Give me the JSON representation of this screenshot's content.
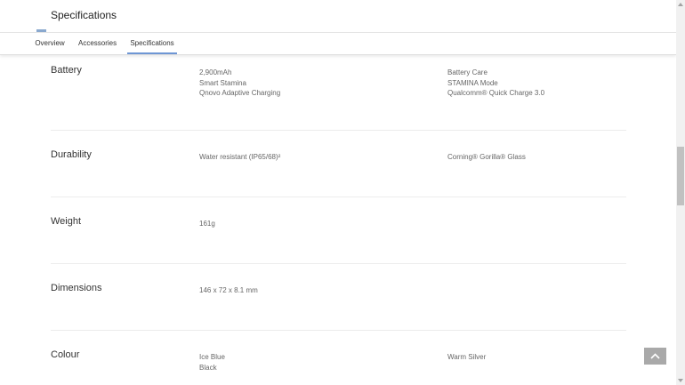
{
  "header": {
    "title": "Specifications"
  },
  "tabs": [
    {
      "label": "Overview"
    },
    {
      "label": "Accessories"
    },
    {
      "label": "Specifications",
      "active": true
    }
  ],
  "specs": {
    "battery": {
      "label": "Battery",
      "col1": [
        "2,900mAh",
        "Smart Stamina",
        "Qnovo Adaptive Charging"
      ],
      "col2": [
        "Battery Care",
        "STAMINA Mode",
        "Qualcomm® Quick Charge 3.0"
      ]
    },
    "durability": {
      "label": "Durability",
      "col1": [
        "Water resistant (IP65/68)²"
      ],
      "col2": [
        "Corning® Gorilla® Glass"
      ]
    },
    "weight": {
      "label": "Weight",
      "col1": [
        "161g"
      ]
    },
    "dimensions": {
      "label": "Dimensions",
      "col1": [
        "146 x 72 x 8.1 mm"
      ]
    },
    "colour": {
      "label": "Colour",
      "col1": [
        "Ice Blue",
        "Black"
      ],
      "col2": [
        "Warm Silver"
      ]
    }
  },
  "icons": {
    "back_to_top": "chevron-up-icon"
  },
  "colors": {
    "accent": "#6e96d4",
    "back_to_top_bg": "#a9a9a9"
  }
}
